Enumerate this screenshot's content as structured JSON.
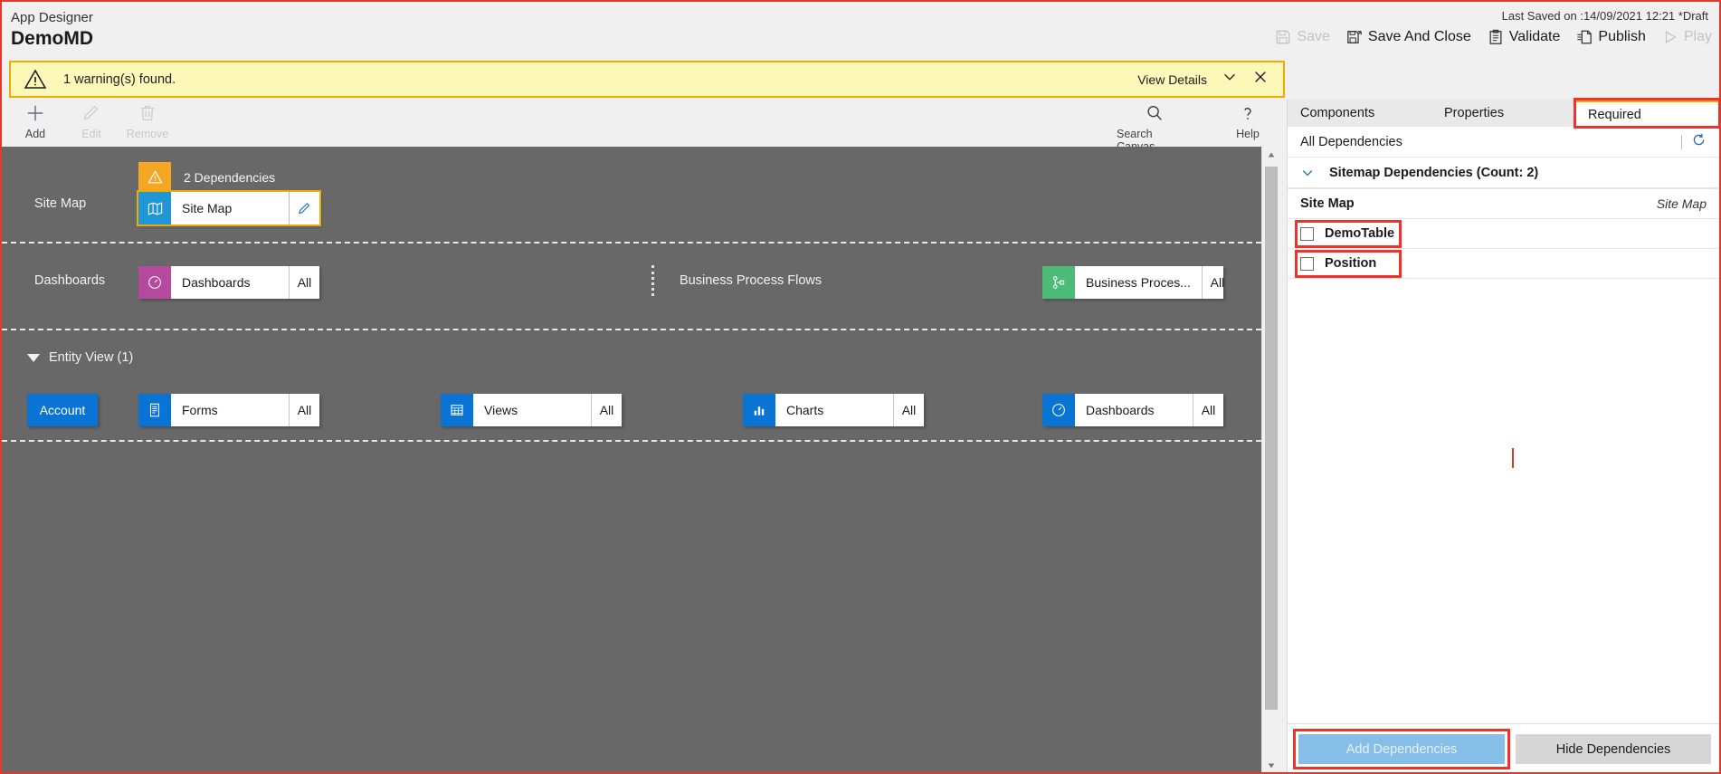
{
  "header": {
    "app_label": "App Designer",
    "app_name": "DemoMD",
    "last_saved": "Last Saved on :14/09/2021 12:21 *Draft",
    "actions": [
      {
        "label": "Save",
        "icon": "save-icon",
        "disabled": true
      },
      {
        "label": "Save And Close",
        "icon": "save-close-icon",
        "disabled": false
      },
      {
        "label": "Validate",
        "icon": "clipboard-check-icon",
        "disabled": false
      },
      {
        "label": "Publish",
        "icon": "publish-icon",
        "disabled": false
      },
      {
        "label": "Play",
        "icon": "play-icon",
        "disabled": true
      }
    ]
  },
  "warning_bar": {
    "icon": "warning-triangle-icon",
    "message": "1 warning(s) found.",
    "view_details": "View Details",
    "chevron_icon": "chevron-down-icon",
    "close_icon": "close-icon"
  },
  "command_bar": {
    "left": [
      {
        "label": "Add",
        "icon": "plus-icon",
        "disabled": false
      },
      {
        "label": "Edit",
        "icon": "pencil-icon",
        "disabled": true
      },
      {
        "label": "Remove",
        "icon": "trash-icon",
        "disabled": true
      }
    ],
    "right": [
      {
        "label": "Search Canvas",
        "icon": "search-icon",
        "disabled": false
      },
      {
        "label": "Help",
        "icon": "question-icon",
        "disabled": false
      }
    ]
  },
  "canvas": {
    "sitemap_row": {
      "label": "Site Map",
      "dependency_badge": "2 Dependencies",
      "dependency_icon": "warning-triangle-icon",
      "tile": {
        "name": "Site Map",
        "icon": "sitemap-icon",
        "edit_icon": "pencil-icon"
      }
    },
    "dashboards_row": {
      "label": "Dashboards",
      "tile": {
        "name": "Dashboards",
        "icon": "dashboard-icon",
        "scope": "All"
      }
    },
    "bpf_row": {
      "label": "Business Process Flows",
      "tile": {
        "name": "Business Proces...",
        "icon": "process-flow-icon",
        "scope": "All"
      }
    },
    "entity_view": {
      "header": "Entity View (1)",
      "toggle_icon": "triangle-down-icon",
      "entity_chip": "Account",
      "tiles": [
        {
          "name": "Forms",
          "icon": "forms-icon",
          "scope": "All"
        },
        {
          "name": "Views",
          "icon": "views-grid-icon",
          "scope": "All"
        },
        {
          "name": "Charts",
          "icon": "bar-chart-icon",
          "scope": "All"
        },
        {
          "name": "Dashboards",
          "icon": "dashboard-icon",
          "scope": "All"
        }
      ]
    }
  },
  "right_panel": {
    "tabs": [
      {
        "label": "Components",
        "active": false,
        "highlighted": false
      },
      {
        "label": "Properties",
        "active": false,
        "highlighted": false
      },
      {
        "label": "Required",
        "active": true,
        "highlighted": true
      }
    ],
    "all_dependencies_label": "All Dependencies",
    "refresh_icon": "refresh-icon",
    "group": {
      "label": "Sitemap Dependencies (Count: 2)",
      "chevron_icon": "chevron-down-icon"
    },
    "section": {
      "name": "Site Map",
      "type": "Site Map"
    },
    "items": [
      {
        "label": "DemoTable",
        "checked": false,
        "highlighted": true
      },
      {
        "label": "Position",
        "checked": false,
        "highlighted": true
      }
    ],
    "footer": {
      "add_label": "Add Dependencies",
      "add_disabled": true,
      "add_highlighted": true,
      "hide_label": "Hide Dependencies"
    }
  },
  "colors": {
    "accent_blue": "#0a74d4",
    "warning_yellow": "#f0ab00",
    "warning_bg": "#fbf8b8",
    "highlight_red": "#f0322a",
    "canvas_gray": "#686868",
    "dashboard_purple": "#b4499e",
    "bpf_green": "#4cbb78"
  }
}
